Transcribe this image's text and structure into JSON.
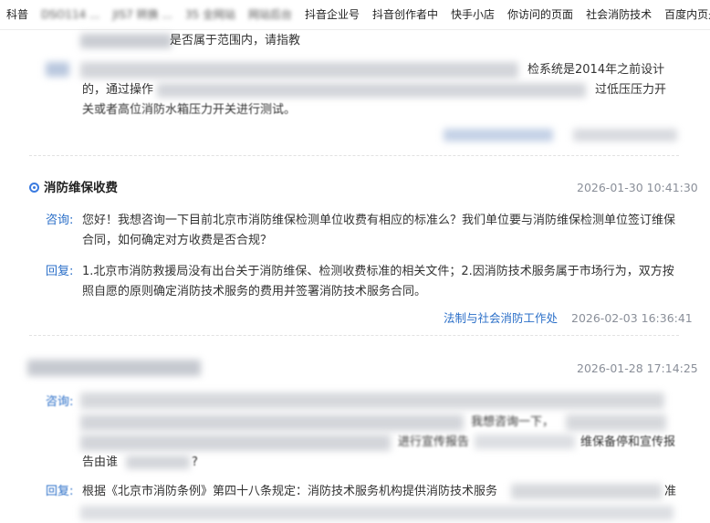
{
  "bookmarks": [
    {
      "label": "科普",
      "blurred": false
    },
    {
      "label": "DSO114 ...",
      "blurred": true
    },
    {
      "label": "JIS7 转换 ...",
      "blurred": true
    },
    {
      "label": "35 全网站",
      "blurred": true
    },
    {
      "label": "网站后台",
      "blurred": true
    },
    {
      "label": "抖音企业号",
      "blurred": false
    },
    {
      "label": "抖音创作者中",
      "blurred": false
    },
    {
      "label": "快手小店",
      "blurred": false
    },
    {
      "label": "你访问的页面",
      "blurred": false
    },
    {
      "label": "社会消防技术",
      "blurred": false
    },
    {
      "label": "百度内页是否",
      "blurred": false
    }
  ],
  "entry0": {
    "question_tail": "是否属于范围内，请指教",
    "answer_line1_tail": "检系统是2014年之前设计",
    "answer_line2_start": "的，通过操作",
    "answer_line2_end": "过低压压力开",
    "answer_line3": "关或者高位消防水箱压力开关进行测试。"
  },
  "entry1": {
    "title": "消防维保收费",
    "date": "2026-01-30 10:41:30",
    "ask_label": "咨询:",
    "ask_line1": "您好！我想咨询一下目前北京市消防维保检测单位收费有相应的标准么？我们单位要与消防维保检测单位签订维保",
    "ask_line2": "合同，如何确定对方收费是否合规？",
    "reply_label": "回复:",
    "reply_line1": "1.北京市消防救援局没有出台关于消防维保、检测收费标准的相关文件；2.因消防技术服务属于市场行为，双方按",
    "reply_line2": "照自愿的原则确定消防技术服务的费用并签署消防技术服务合同。",
    "dept": "法制与社会消防工作处",
    "reply_date": "2026-02-03 16:36:41"
  },
  "entry2": {
    "date": "2026-01-28 17:14:25",
    "ask_label": "咨询:",
    "ask_tail1": "我想咨询一下，",
    "ask_tail2": "进行宣传报告",
    "ask_tail3": "维保备停和宣传报",
    "ask_line4": "告由谁",
    "ask_line4_end": "?",
    "reply_label": "回复:",
    "reply_line1": "根据《北京市消防条例》第四十八条规定：消防技术服务机构提供消防技术服务",
    "reply_line1_end": "准"
  },
  "colors": {
    "accent": "#2b6fc8",
    "date": "#8a8f99",
    "text": "#333333"
  }
}
